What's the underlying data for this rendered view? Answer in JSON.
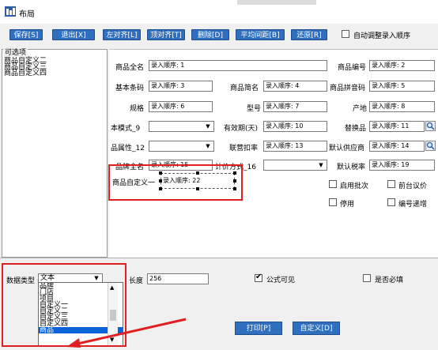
{
  "window": {
    "title": "布局"
  },
  "toolbar": {
    "save": "保存[S]",
    "exit": "退出[X]",
    "align_left": "左对齐[L]",
    "align_top": "顶对齐[T]",
    "delete": "删除[D]",
    "distribute": "平均间距[B]",
    "restore": "还原[R]",
    "auto_adjust": "自动调整录入顺序"
  },
  "left_panel": {
    "title": "可选项",
    "items": [
      "商品自定义二",
      "商品自定义三",
      "商品自定义四"
    ]
  },
  "form": {
    "full_name_label": "商品全名",
    "full_name_value": "录入顺序: 1",
    "code_label": "商品编号",
    "code_value": "录入顺序: 2",
    "barcode_label": "基本条码",
    "barcode_value": "录入顺序: 3",
    "short_name_label": "商品简名",
    "short_name_value": "录入顺序: 4",
    "pinyin_label": "商品拼音码",
    "pinyin_value": "录入顺序: 5",
    "spec_label": "规格",
    "spec_value": "录入顺序: 6",
    "model_label": "型号",
    "model_value": "录入顺序: 7",
    "origin_label": "产地",
    "origin_value": "录入顺序: 8",
    "mode_label": "本模式_9",
    "expiry_label": "有效期(天)",
    "expiry_value": "录入顺序: 10",
    "substitute_label": "替换品",
    "substitute_value": "录入顺序: 11",
    "attr_label": "品属性_12",
    "deduct_label": "联营扣率",
    "deduct_value": "录入顺序: 13",
    "supplier_label": "默认供应商",
    "supplier_value": "录入顺序: 14",
    "brand_label": "品牌全名",
    "brand_value": "录入顺序: 15",
    "pricing_label": "计价方式_16",
    "tax_label": "默认税率",
    "tax_value": "录入顺序: 19",
    "custom1_label": "商品自定义一",
    "custom1_value": "录入顺序: 22",
    "batch_label": "启用批次",
    "presale_label": "前台议价",
    "disabled_label": "停用",
    "code_inc_label": "编号递增"
  },
  "bottom": {
    "data_type_label": "数据类型",
    "data_type_value": "文本",
    "length_label": "长度",
    "length_value": "256",
    "formula_visible_label": "公式可见",
    "required_label": "是否必填",
    "print_button": "打印[P]",
    "custom_button": "自定义[D]",
    "dropdown_options": [
      "品牌",
      "门店",
      "项目",
      "自定义一",
      "自定义二",
      "自定义三",
      "自定义四",
      "商品"
    ],
    "dropdown_selected": "商品"
  },
  "colors": {
    "button_blue": "#2f6fbd",
    "highlight_red": "#e02020",
    "selection": "#0a64d8"
  }
}
